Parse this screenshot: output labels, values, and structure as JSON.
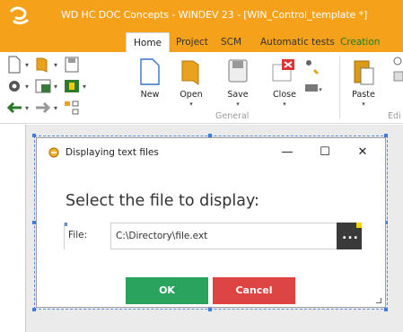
{
  "window": {
    "title": "WD HC DOC Concepts - WINDEV 23 - [WIN_Control_template *]"
  },
  "tabs": [
    {
      "label": "Home"
    },
    {
      "label": "Project"
    },
    {
      "label": "SCM"
    },
    {
      "label": "Automatic tests"
    },
    {
      "label": "Creation"
    }
  ],
  "ribbon": {
    "buttons": {
      "new": "New",
      "open": "Open",
      "save": "Save",
      "close": "Close",
      "paste": "Paste"
    },
    "groups": {
      "general": "General",
      "edit_partial": "Edi"
    }
  },
  "dialog": {
    "title": "Displaying text files",
    "heading": "Select the file to display:",
    "file_label": "File:",
    "file_value": "C:\\Directory\\file.ext",
    "browse_label": "...",
    "ok_label": "OK",
    "cancel_label": "Cancel",
    "minimize_label": "—",
    "maximize_label": "☐",
    "close_label": "✕"
  },
  "colors": {
    "titlebar": "#f5a21a",
    "ok": "#2aa35f",
    "cancel": "#dd4444",
    "browse": "#3a3a3a"
  }
}
